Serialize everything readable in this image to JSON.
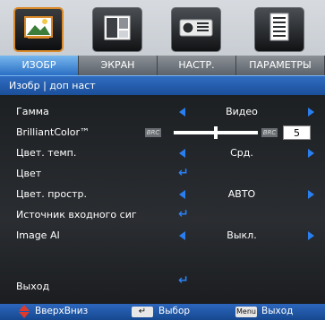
{
  "tabs": [
    {
      "label": "ИЗОБР",
      "icon": "image-icon",
      "active": true
    },
    {
      "label": "ЭКРАН",
      "icon": "display-icon",
      "active": false
    },
    {
      "label": "НАСТР.",
      "icon": "projector-icon",
      "active": false
    },
    {
      "label": "ПАРАМЕТРЫ",
      "icon": "options-icon",
      "active": false
    }
  ],
  "breadcrumb": "Изобр | доп наст",
  "rows": [
    {
      "label": "Гамма",
      "value": "Видео",
      "control": "select"
    },
    {
      "label": "BrilliantColor™",
      "value": "5",
      "control": "slider",
      "min_label": "BRC",
      "max_label": "BRC",
      "level": 0.5
    },
    {
      "label": "Цвет. темп.",
      "value": "Срд.",
      "control": "select"
    },
    {
      "label": "Цвет",
      "control": "enter"
    },
    {
      "label": "Цвет. простр.",
      "value": "АВТО",
      "control": "select"
    },
    {
      "label": "Источник входного сиг",
      "control": "enter"
    },
    {
      "label": "Image AI",
      "value": "Выкл.",
      "control": "select"
    }
  ],
  "exit_label": "Выход",
  "footer": {
    "updown_label": "ВверхВниз",
    "enter_key": "↵",
    "select_label": "Выбор",
    "menu_key": "Menu",
    "exit_label": "Выход"
  },
  "colors": {
    "accent_blue": "#2a7ff0",
    "active_tab_border": "#d98a2b",
    "updown_red": "#e03a2c"
  }
}
